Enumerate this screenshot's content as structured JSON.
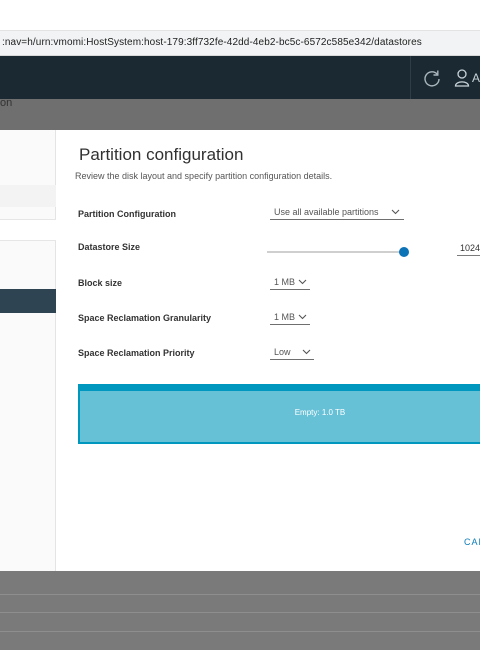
{
  "browser": {
    "url": ":nav=h/urn:vmomi:HostSystem:host-179:3ff732fe-42dd-4eb2-bc5c-6572c585e342/datastores"
  },
  "header": {
    "icons": [
      "refresh-icon",
      "user-icon"
    ],
    "user_initial": "A"
  },
  "sidebar": {
    "partial_step_text": "on"
  },
  "wizard": {
    "title": "Partition configuration",
    "subtitle": "Review the disk layout and specify partition configuration details.",
    "fields": {
      "partition_configuration": {
        "label": "Partition Configuration",
        "value": "Use all available partitions"
      },
      "datastore_size": {
        "label": "Datastore Size",
        "value": "1024",
        "slider_level": 1.0
      },
      "block_size": {
        "label": "Block size",
        "value": "1 MB"
      },
      "space_reclamation_granularity": {
        "label": "Space Reclamation Granularity",
        "value": "1 MB"
      },
      "space_reclamation_priority": {
        "label": "Space Reclamation Priority",
        "value": "Low"
      }
    },
    "disk_layout": {
      "label": "Empty: 1.0 TB"
    },
    "buttons": {
      "cancel": "CAN"
    }
  },
  "colors": {
    "header_bg": "#1b2a32",
    "accent": "#0b73b6",
    "partition_border": "#0097bf",
    "partition_fill": "#66c0d6",
    "active_step_bg": "#2f4452"
  }
}
